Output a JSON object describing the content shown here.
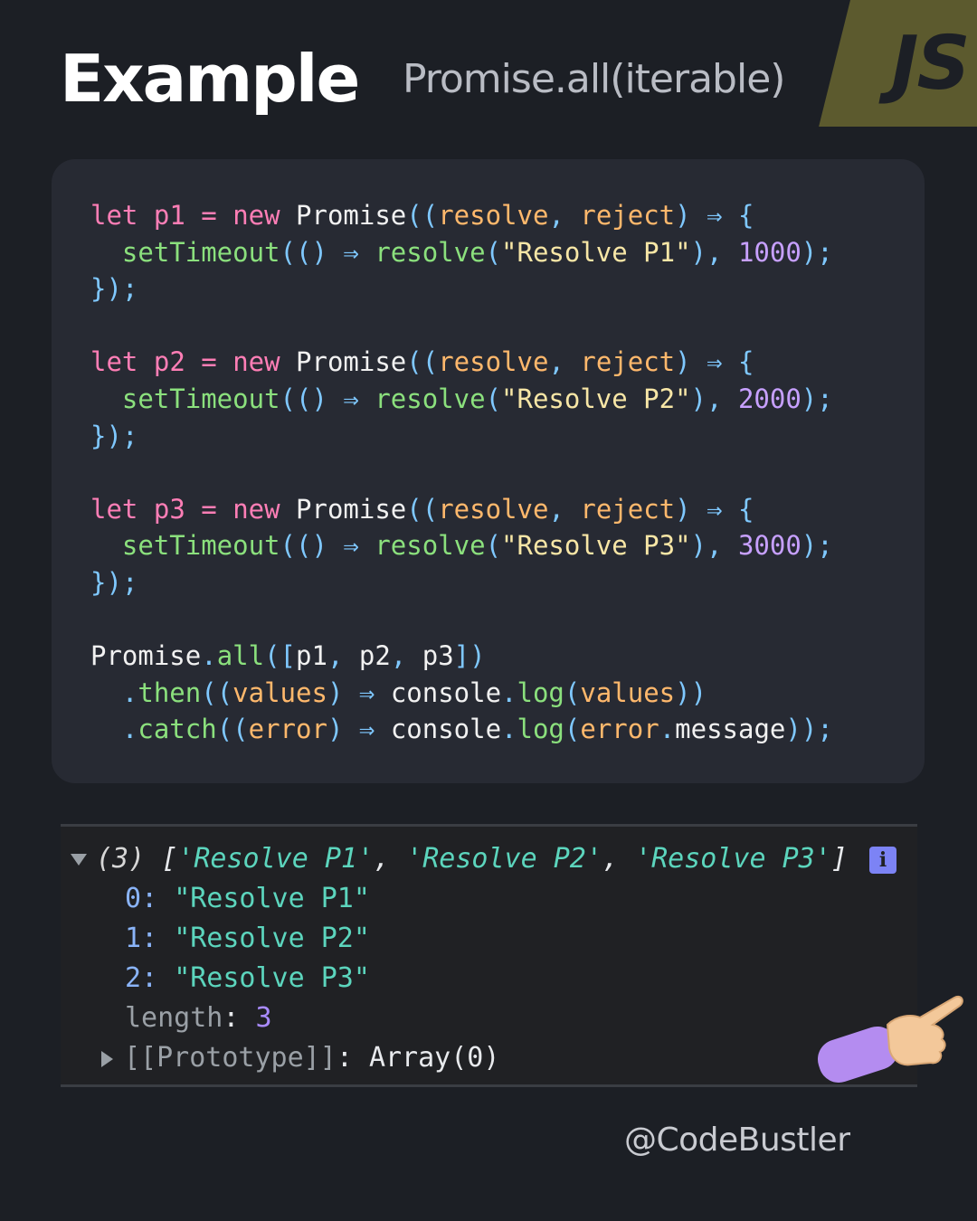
{
  "header": {
    "title": "Example",
    "subtitle": "Promise.all(iterable)",
    "badge": "JS"
  },
  "code_lines": [
    "let p1 = new Promise((resolve, reject) ⇒ {",
    "  setTimeout(() ⇒ resolve(\"Resolve P1\"), 1000);",
    "});",
    "",
    "let p2 = new Promise((resolve, reject) ⇒ {",
    "  setTimeout(() ⇒ resolve(\"Resolve P2\"), 2000);",
    "});",
    "",
    "let p3 = new Promise((resolve, reject) ⇒ {",
    "  setTimeout(() ⇒ resolve(\"Resolve P3\"), 3000);",
    "});",
    "",
    "Promise.all([p1, p2, p3])",
    "  .then((values) ⇒ console.log(values))",
    "  .catch((error) ⇒ console.log(error.message));"
  ],
  "console": {
    "summary_count": "(3)",
    "summary_items": [
      "'Resolve P1'",
      "'Resolve P2'",
      "'Resolve P3'"
    ],
    "entries": [
      {
        "index": "0",
        "value": "\"Resolve P1\""
      },
      {
        "index": "1",
        "value": "\"Resolve P2\""
      },
      {
        "index": "2",
        "value": "\"Resolve P3\""
      }
    ],
    "length_label": "length",
    "length_value": "3",
    "prototype_label": "[[Prototype]]",
    "prototype_value": "Array(0)",
    "info_icon_glyph": "i"
  },
  "footer": {
    "handle": "@CodeBustler"
  },
  "icons": {
    "expand": "triangle-down-icon",
    "collapse": "triangle-right-icon",
    "info": "info-icon",
    "hand": "pointing-hand-icon"
  },
  "colors": {
    "background": "#1c1f25",
    "code_card": "#272a33",
    "keyword": "#ff7eb6",
    "function": "#8be07d",
    "string": "#f7e6a6",
    "number": "#c7a0ff",
    "console_string": "#5cd5bd",
    "js_badge": "#5c5a2e"
  }
}
